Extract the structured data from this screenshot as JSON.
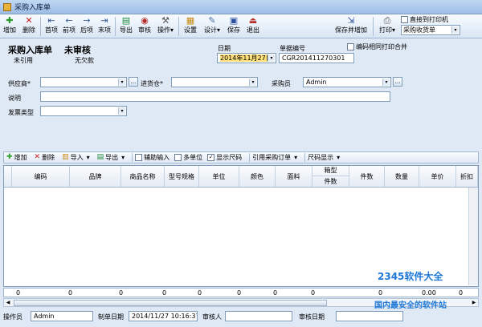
{
  "window": {
    "title": "采购入库单"
  },
  "toolbar": {
    "add": "增加",
    "delete": "删除",
    "first": "首项",
    "prev": "前项",
    "next": "后项",
    "last": "末项",
    "export": "导出",
    "audit": "审核",
    "ops": "操作",
    "settings": "设置",
    "design": "设计",
    "save": "保存",
    "exit": "退出",
    "save_add": "保存并增加",
    "print": "打印",
    "direct_print": "直接到打印机",
    "print_template": "采购收货单"
  },
  "header": {
    "doc_title": "采购入库单",
    "audit_status": "未审核",
    "ref_status": "未引用",
    "debt_status": "无欠款",
    "date_label": "日期",
    "date_value": "2014年11月27日",
    "docno_label": "单据编号",
    "docno_value": "CGR201411270301",
    "merge_print_label": "编码相同打印合并"
  },
  "form": {
    "supplier_label": "供应商*",
    "supplier_value": "",
    "warehouse_label": "进货仓*",
    "warehouse_value": "",
    "buyer_label": "采购员",
    "buyer_value": "Admin",
    "note_label": "说明",
    "note_value": "",
    "invoice_label": "发票类型",
    "invoice_value": ""
  },
  "grid_toolbar": {
    "add": "增加",
    "delete": "删除",
    "import": "导入",
    "export": "导出",
    "aux_input": "辅助输入",
    "multi_unit": "多单位",
    "show_size": "显示尺码",
    "ref_po": "引用采购订单",
    "size_display": "尺码显示"
  },
  "grid": {
    "columns": [
      "编码",
      "品牌",
      "商品名称",
      "型号规格",
      "单位",
      "颜色",
      "面料",
      "箱型",
      "件数",
      "件数",
      "数量",
      "单价",
      "折扣"
    ],
    "totals": [
      "0",
      "0",
      "0",
      "0",
      "0",
      "0",
      "0",
      "0",
      "0",
      "0.00",
      "0"
    ]
  },
  "footer": {
    "operator_label": "操作员",
    "operator_value": "Admin",
    "created_label": "制单日期",
    "created_value": "2014/11/27 10:16:37",
    "auditor_label": "审核人",
    "auditor_value": "",
    "audit_date_label": "审核日期",
    "audit_date_value": ""
  },
  "watermark": {
    "site": "2345软件大全",
    "slogan": "国内最安全的软件站"
  },
  "colors": {
    "bg": "#dfe9f5",
    "accent": "#1e78d6",
    "date_highlight": "#ffe07a"
  }
}
